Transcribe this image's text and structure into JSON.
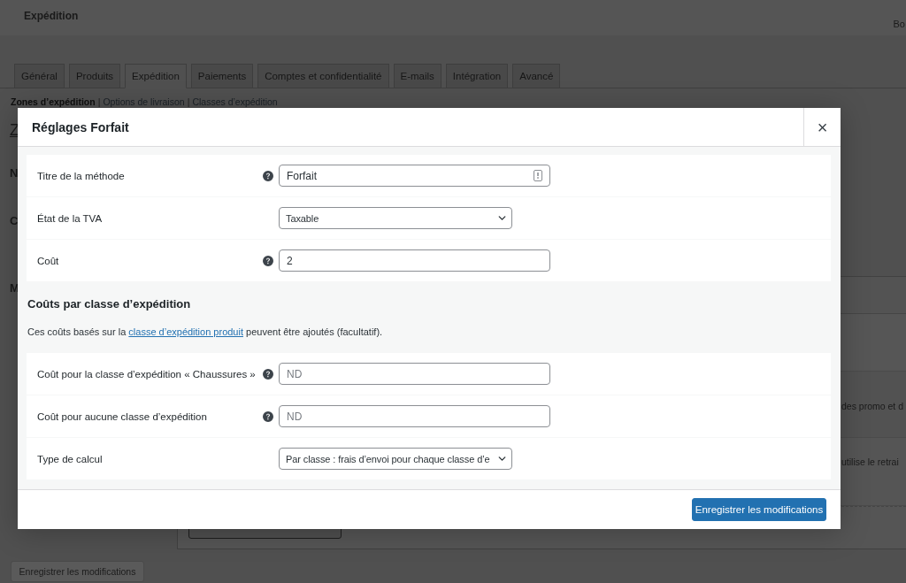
{
  "header": {
    "title": "Expédition",
    "account_fragment": "Bo"
  },
  "tabs": [
    {
      "label": "Général",
      "selected": false
    },
    {
      "label": "Produits",
      "selected": false
    },
    {
      "label": "Expédition",
      "selected": true
    },
    {
      "label": "Paiements",
      "selected": false
    },
    {
      "label": "Comptes et confidentialité",
      "selected": false
    },
    {
      "label": "E-mails",
      "selected": false
    },
    {
      "label": "Intégration",
      "selected": false
    },
    {
      "label": "Avancé",
      "selected": false
    }
  ],
  "subnav": {
    "separator": "|",
    "items": [
      {
        "label": "Zones d’expédition",
        "selected": true
      },
      {
        "label": "Options de livraison",
        "selected": false
      },
      {
        "label": "Classes d’expédition",
        "selected": false
      }
    ]
  },
  "background": {
    "heading_fragment": "Z",
    "label_fragments": [
      "N",
      "C",
      "M"
    ],
    "row_fragments": [
      "des promo et d",
      "utilise le retrai"
    ],
    "save_button": {
      "label": "Enregistrer les modifications",
      "disabled": true
    }
  },
  "modal": {
    "title": "Réglages Forfait",
    "close": "×",
    "sections": [
      {
        "rows": [
          {
            "label": "Titre de la méthode",
            "help": true,
            "field": {
              "kind": "text",
              "value": "Forfait",
              "autofill": true
            }
          },
          {
            "label": "État de la TVA",
            "help": false,
            "field": {
              "kind": "select",
              "value": "Taxable"
            }
          },
          {
            "label": "Coût",
            "help": true,
            "field": {
              "kind": "text",
              "value": "2",
              "autofill": false
            }
          }
        ]
      },
      {
        "heading": "Coûts par classe d’expédition",
        "description": {
          "before": "Ces coûts basés sur la ",
          "link": "classe d’expédition produit",
          "after": " peuvent être ajoutés (facultatif)."
        },
        "rows": [
          {
            "label": "Coût pour la classe d’expédition « Chaussures »",
            "help": true,
            "field": {
              "kind": "text",
              "placeholder": "ND",
              "autofill": false
            }
          },
          {
            "label": "Coût pour aucune classe d’expédition",
            "help": true,
            "field": {
              "kind": "text",
              "placeholder": "ND",
              "autofill": false
            }
          },
          {
            "label": "Type de calcul",
            "help": false,
            "field": {
              "kind": "select",
              "value": "Par classe : frais d’envoi pour chaque classe d’e"
            }
          }
        ]
      }
    ],
    "save_button": "Enregistrer les modifications"
  }
}
